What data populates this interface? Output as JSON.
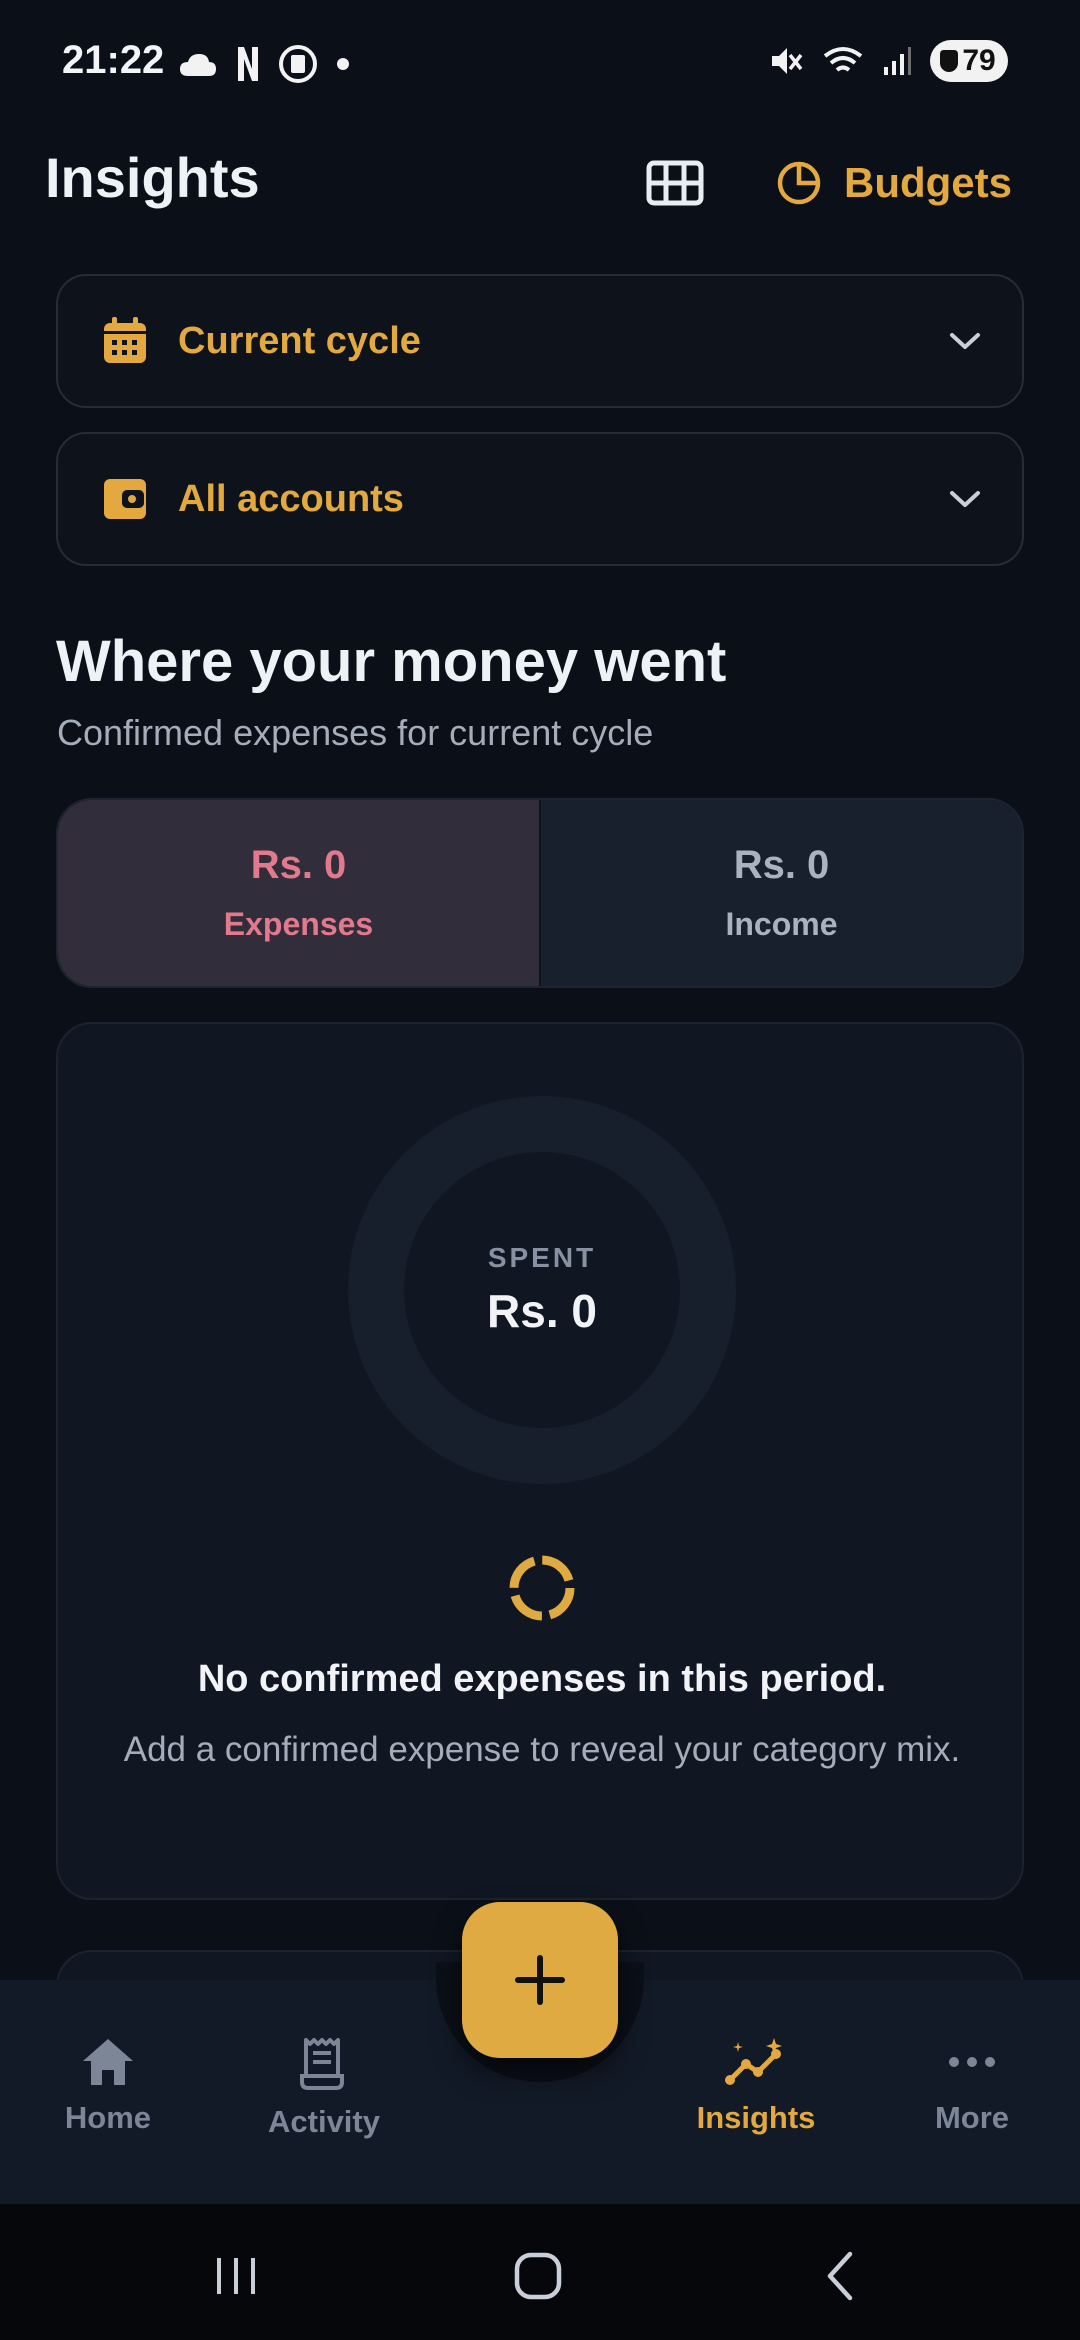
{
  "status_bar": {
    "time": "21:22",
    "battery": "79"
  },
  "header": {
    "title": "Insights",
    "budgets_label": "Budgets"
  },
  "filters": {
    "cycle_label": "Current cycle",
    "accounts_label": "All accounts"
  },
  "summary": {
    "title": "Where your money went",
    "subtitle": "Confirmed expenses for current cycle"
  },
  "toggle": {
    "expenses_amount": "Rs. 0",
    "expenses_label": "Expenses",
    "income_amount": "Rs. 0",
    "income_label": "Income",
    "selected": "Expenses"
  },
  "donut": {
    "caption": "SPENT",
    "amount": "Rs. 0"
  },
  "empty_state": {
    "title": "No confirmed expenses in this period.",
    "description": "Add a confirmed expense to reveal your category mix."
  },
  "bottom_nav": {
    "items": [
      {
        "label": "Home",
        "icon": "home-icon"
      },
      {
        "label": "Activity",
        "icon": "receipt-icon"
      },
      {
        "label": "Insights",
        "icon": "insights-icon",
        "active": true
      },
      {
        "label": "More",
        "icon": "more-icon"
      }
    ]
  },
  "colors": {
    "accent": "#e3a93f",
    "background": "#0b0f17",
    "expense": "#e27a8e"
  }
}
